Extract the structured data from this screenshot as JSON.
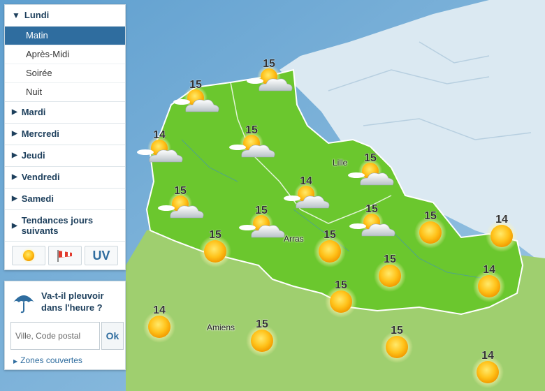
{
  "days": [
    {
      "label": "Lundi",
      "open": true,
      "slots": [
        {
          "label": "Matin",
          "active": true
        },
        {
          "label": "Après-Midi",
          "active": false
        },
        {
          "label": "Soirée",
          "active": false
        },
        {
          "label": "Nuit",
          "active": false
        }
      ]
    },
    {
      "label": "Mardi"
    },
    {
      "label": "Mercredi"
    },
    {
      "label": "Jeudi"
    },
    {
      "label": "Vendredi"
    },
    {
      "label": "Samedi"
    },
    {
      "label": "Tendances jours suivants"
    }
  ],
  "tools": {
    "sun_icon": "sun-icon",
    "wind_icon": "windsock-icon",
    "uv_label": "UV"
  },
  "rain": {
    "title": "Va-t-il pleuvoir dans l'heure ?",
    "placeholder": "Ville, Code postal",
    "ok_label": "Ok",
    "zones_link": "Zones couvertes"
  },
  "cities": {
    "lille": "Lille",
    "arras": "Arras",
    "amiens": "Amiens"
  },
  "forecasts": [
    {
      "temp": "15",
      "icon": "sun-cloud"
    },
    {
      "temp": "15",
      "icon": "sun-cloud"
    },
    {
      "temp": "14",
      "icon": "sun-cloud"
    },
    {
      "temp": "15",
      "icon": "sun-cloud"
    },
    {
      "temp": "15",
      "icon": "sun-cloud"
    },
    {
      "temp": "15",
      "icon": "sun-cloud"
    },
    {
      "temp": "14",
      "icon": "sun-cloud"
    },
    {
      "temp": "15",
      "icon": "sun-cloud"
    },
    {
      "temp": "15",
      "icon": "sun-cloud"
    },
    {
      "temp": "15",
      "icon": "sun"
    },
    {
      "temp": "15",
      "icon": "sun"
    },
    {
      "temp": "15",
      "icon": "sun"
    },
    {
      "temp": "15",
      "icon": "sun"
    },
    {
      "temp": "14",
      "icon": "sun"
    },
    {
      "temp": "14",
      "icon": "sun"
    },
    {
      "temp": "15",
      "icon": "sun"
    },
    {
      "temp": "14",
      "icon": "sun"
    },
    {
      "temp": "15",
      "icon": "sun"
    },
    {
      "temp": "15",
      "icon": "sun"
    },
    {
      "temp": "14",
      "icon": "sun"
    }
  ]
}
